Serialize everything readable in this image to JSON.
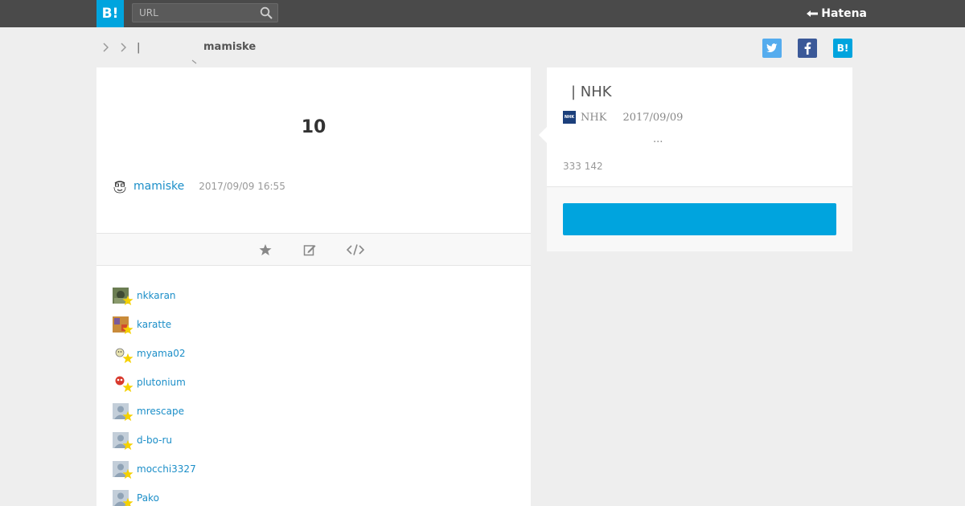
{
  "header": {
    "logo_text": "B!",
    "search_placeholder": "URL",
    "brand": "Hatena"
  },
  "breadcrumb": {
    "separator": "|",
    "username": "mamiske"
  },
  "share": {
    "twitter_icon": "twitter-icon",
    "facebook_icon": "facebook-icon",
    "hatena_label": "B!"
  },
  "entry": {
    "headline": "10",
    "author": "mamiske",
    "datetime": "2017/09/09 16:55"
  },
  "users": [
    {
      "name": "nkkaran"
    },
    {
      "name": "karatte"
    },
    {
      "name": "myama02"
    },
    {
      "name": "plutonium"
    },
    {
      "name": "mrescape"
    },
    {
      "name": "d-bo-ru"
    },
    {
      "name": "mocchi3327"
    },
    {
      "name": "Pako"
    }
  ],
  "article": {
    "title": "| NHK",
    "source": "NHK",
    "date": "2017/09/09",
    "description": "...",
    "counts": "333 142",
    "button_label": ""
  },
  "colors": {
    "accent": "#00a4de",
    "link": "#1b8ec8",
    "topbar": "#4a4a4a",
    "star": "#f5d100"
  }
}
